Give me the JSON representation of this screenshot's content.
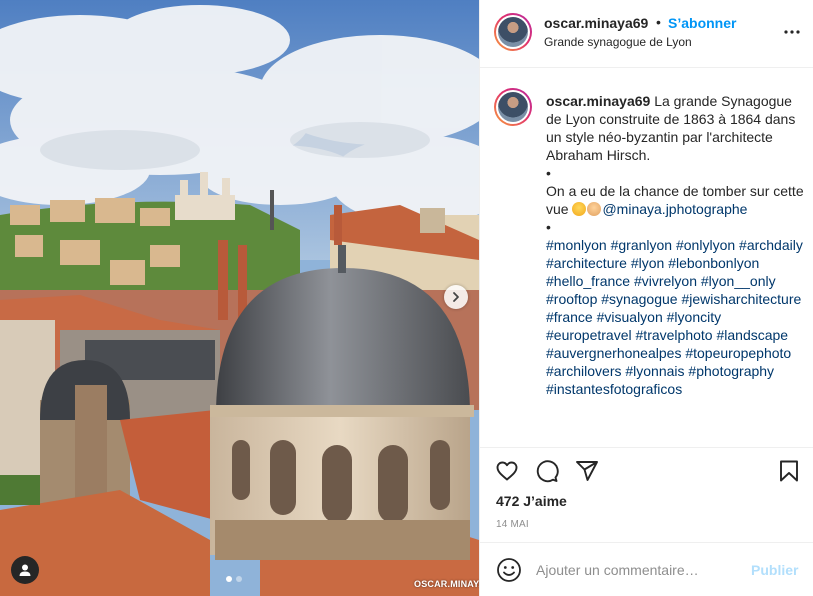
{
  "post": {
    "image": {
      "description_icon": "photo",
      "watermark": "OSCAR.MINAYA",
      "carousel_count": 2,
      "carousel_active": 1
    },
    "header": {
      "username": "oscar.minaya69",
      "separator": "•",
      "follow_label": "S’abonner",
      "location": "Grande synagogue de Lyon"
    },
    "caption": {
      "username": "oscar.minaya69",
      "text": "La grande Synagogue de Lyon construite de 1863 à 1864 dans un style néo-byzantin par l'architecte Abraham Hirsch.",
      "bullet1": "•",
      "line2": "On a eu de la chance de tomber sur cette vue",
      "mention": "@minaya.jphotographe",
      "bullet2": "•",
      "hashtags": [
        "#monlyon",
        "#granlyon",
        "#onlylyon",
        "#archdaily",
        "#architecture",
        "#lyon",
        "#lebonbonlyon",
        "#hello_france",
        "#vivrelyon",
        "#lyon__only",
        "#rooftop",
        "#synagogue",
        "#jewisharchitecture",
        "#france",
        "#visualyon",
        "#lyoncity",
        "#europetravel",
        "#travelphoto",
        "#landscape",
        "#auvergnerhonealpes",
        "#topeuropephoto",
        "#archilovers",
        "#lyonnais",
        "#photography",
        "#instantesfotograficos"
      ]
    },
    "likes": "472 J’aime",
    "date": "14 MAI",
    "comment": {
      "placeholder": "Ajouter un commentaire…",
      "publish_label": "Publier"
    },
    "colors": {
      "accent": "#0095f6",
      "link": "#00376b",
      "publish_disabled": "#b2dffc",
      "muted": "#8e8e8e"
    }
  }
}
